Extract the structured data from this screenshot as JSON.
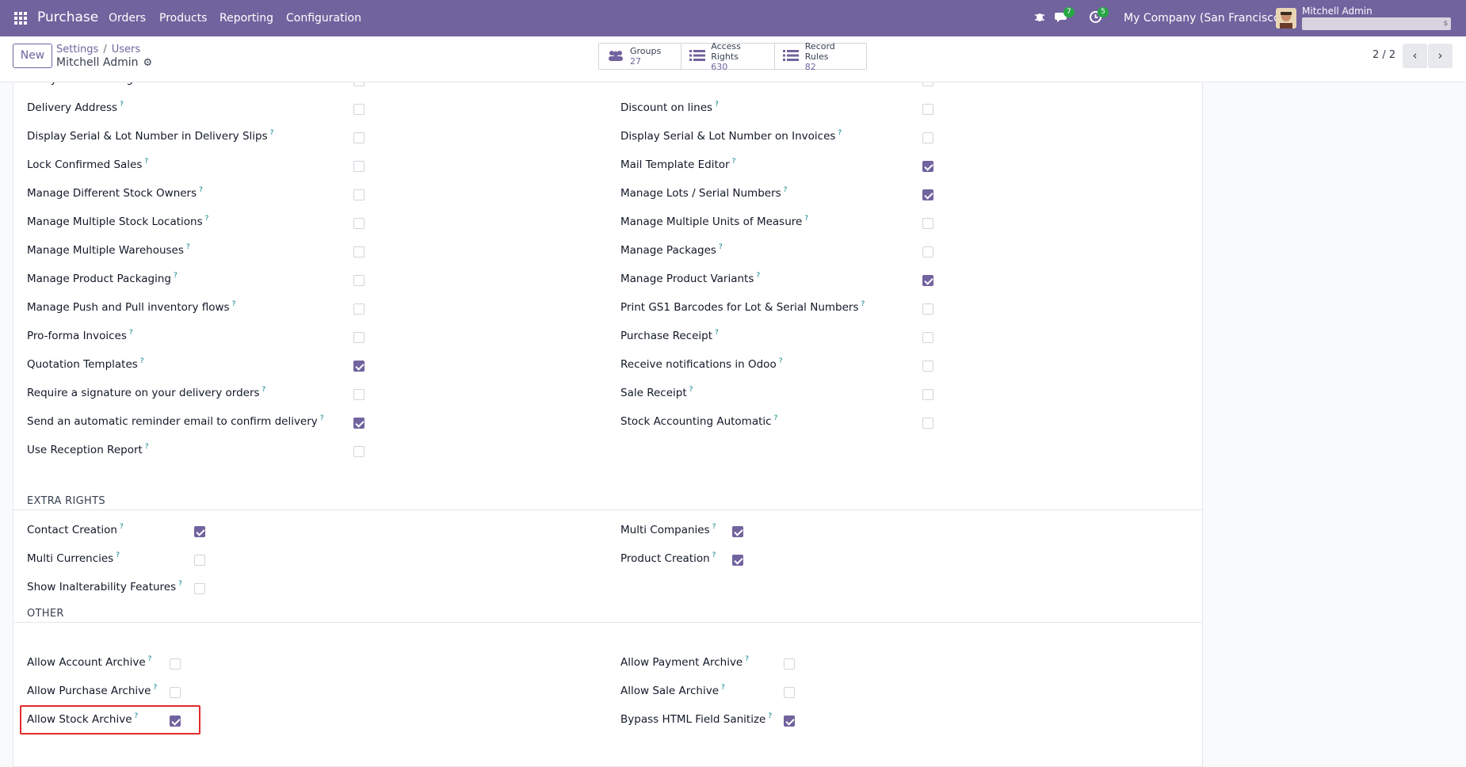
{
  "navbar": {
    "app_name": "Purchase",
    "menu": [
      "Orders",
      "Products",
      "Reporting",
      "Configuration"
    ],
    "chat_count": "7",
    "activity_count": "5",
    "company": "My Company (San Francisco)",
    "user_name": "Mitchell Admin",
    "user_db_suffix": "s"
  },
  "control": {
    "new_label": "New",
    "breadcrumb": [
      "Settings",
      "Users"
    ],
    "record_title": "Mitchell Admin",
    "stats": [
      {
        "label": "Groups",
        "value": "27",
        "icon": "users-icon"
      },
      {
        "label": "Access Rights",
        "value": "630",
        "icon": "list-icon"
      },
      {
        "label": "Record Rules",
        "value": "82",
        "icon": "list-icon"
      }
    ],
    "pager": "2 / 2"
  },
  "technical_left": [
    {
      "label": "Analytic Accounting",
      "checked": false
    },
    {
      "label": "Delivery Address",
      "checked": false
    },
    {
      "label": "Display Serial & Lot Number in Delivery Slips",
      "checked": false
    },
    {
      "label": "Lock Confirmed Sales",
      "checked": false
    },
    {
      "label": "Manage Different Stock Owners",
      "checked": false
    },
    {
      "label": "Manage Multiple Stock Locations",
      "checked": false
    },
    {
      "label": "Manage Multiple Warehouses",
      "checked": false
    },
    {
      "label": "Manage Product Packaging",
      "checked": false
    },
    {
      "label": "Manage Push and Pull inventory flows",
      "checked": false
    },
    {
      "label": "Pro-forma Invoices",
      "checked": false
    },
    {
      "label": "Quotation Templates",
      "checked": true
    },
    {
      "label": "Require a signature on your delivery orders",
      "checked": false
    },
    {
      "label": "Send an automatic reminder email to confirm delivery",
      "checked": true
    },
    {
      "label": "Use Reception Report",
      "checked": false
    }
  ],
  "technical_right": [
    {
      "label": "Basic Pricelists",
      "checked": false
    },
    {
      "label": "Discount on lines",
      "checked": false
    },
    {
      "label": "Display Serial & Lot Number on Invoices",
      "checked": false
    },
    {
      "label": "Mail Template Editor",
      "checked": true
    },
    {
      "label": "Manage Lots / Serial Numbers",
      "checked": true
    },
    {
      "label": "Manage Multiple Units of Measure",
      "checked": false
    },
    {
      "label": "Manage Packages",
      "checked": false
    },
    {
      "label": "Manage Product Variants",
      "checked": true
    },
    {
      "label": "Print GS1 Barcodes for Lot & Serial Numbers",
      "checked": false
    },
    {
      "label": "Purchase Receipt",
      "checked": false
    },
    {
      "label": "Receive notifications in Odoo",
      "checked": false
    },
    {
      "label": "Sale Receipt",
      "checked": false
    },
    {
      "label": "Stock Accounting Automatic",
      "checked": false
    }
  ],
  "extra_rights": {
    "title": "EXTRA RIGHTS",
    "left": [
      {
        "label": "Contact Creation",
        "checked": true
      },
      {
        "label": "Multi Currencies",
        "checked": false
      },
      {
        "label": "Show Inalterability Features",
        "checked": false
      }
    ],
    "right": [
      {
        "label": "Multi Companies",
        "checked": true
      },
      {
        "label": "Product Creation",
        "checked": true
      }
    ]
  },
  "other": {
    "title": "OTHER",
    "left": [
      {
        "label": "Allow Account Archive",
        "checked": false
      },
      {
        "label": "Allow Purchase Archive",
        "checked": false
      },
      {
        "label": "Allow Stock Archive",
        "checked": true
      }
    ],
    "right": [
      {
        "label": "Allow Payment Archive",
        "checked": false
      },
      {
        "label": "Allow Sale Archive",
        "checked": false
      },
      {
        "label": "Bypass HTML Field Sanitize",
        "checked": true
      }
    ]
  },
  "help_mark": "?",
  "colors": {
    "brand": "#71639e",
    "help": "#017e84",
    "highlight": "#e32b2b"
  }
}
